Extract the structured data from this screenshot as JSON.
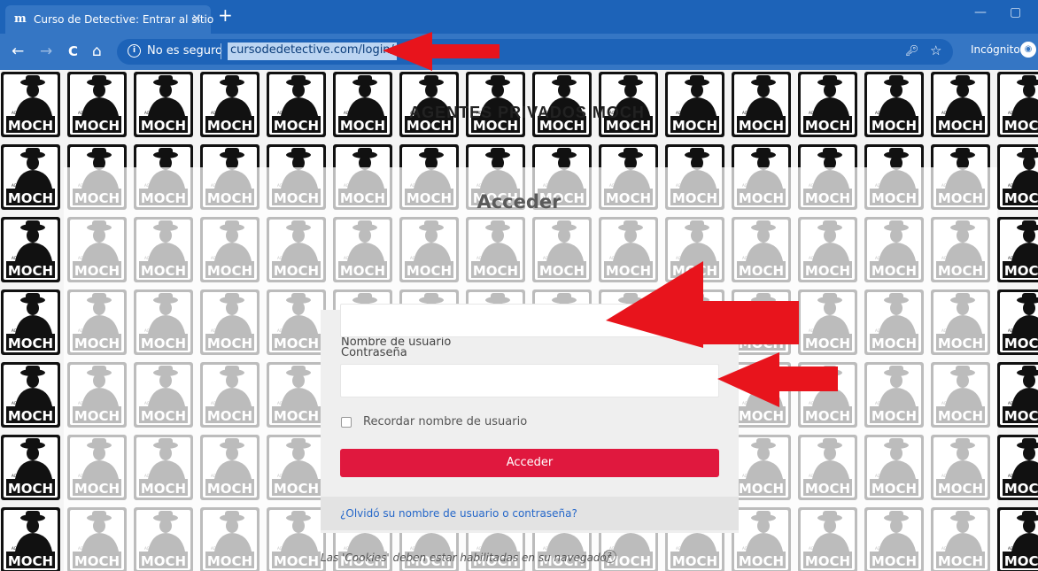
{
  "browser": {
    "tab_icon": "m",
    "tab_title": "Curso de Detective: Entrar al sitio",
    "tab_close": "×",
    "new_tab": "+",
    "back": "←",
    "forward": "→",
    "reload": "C",
    "home": "⌂",
    "security_label": "No es seguro",
    "url": "cursodedetective.com/login/",
    "mode_label": "Incógnito",
    "minimize": "—",
    "restore": "▢"
  },
  "page": {
    "brand": "AGENTES PRIVADOS MOCH",
    "heading": "Acceder",
    "username_label": "Nombre de usuario",
    "username_value": "",
    "password_label": "Contraseña",
    "password_value": "",
    "remember_label": "Recordar nombre de usuario",
    "submit_label": "Acceder",
    "forgot_link": "¿Olvidó su nombre de usuario o contraseña?",
    "cookies_notice": "Las 'Cookies' deben estar habilitadas en su navegador",
    "help_symbol": "?",
    "logo_text": "MOCH",
    "logo_subtext": "AGENTES PRIVADOS"
  },
  "colors": {
    "tab_bar": "#1d63b8",
    "toolbar": "#3576c4",
    "submit_button": "#e0183e",
    "annotation_arrow": "#e8141c",
    "link": "#2567c9"
  },
  "icons": [
    "info-icon",
    "key-icon",
    "star-icon",
    "incognito-icon",
    "help-icon",
    "detective-logo-icon"
  ]
}
